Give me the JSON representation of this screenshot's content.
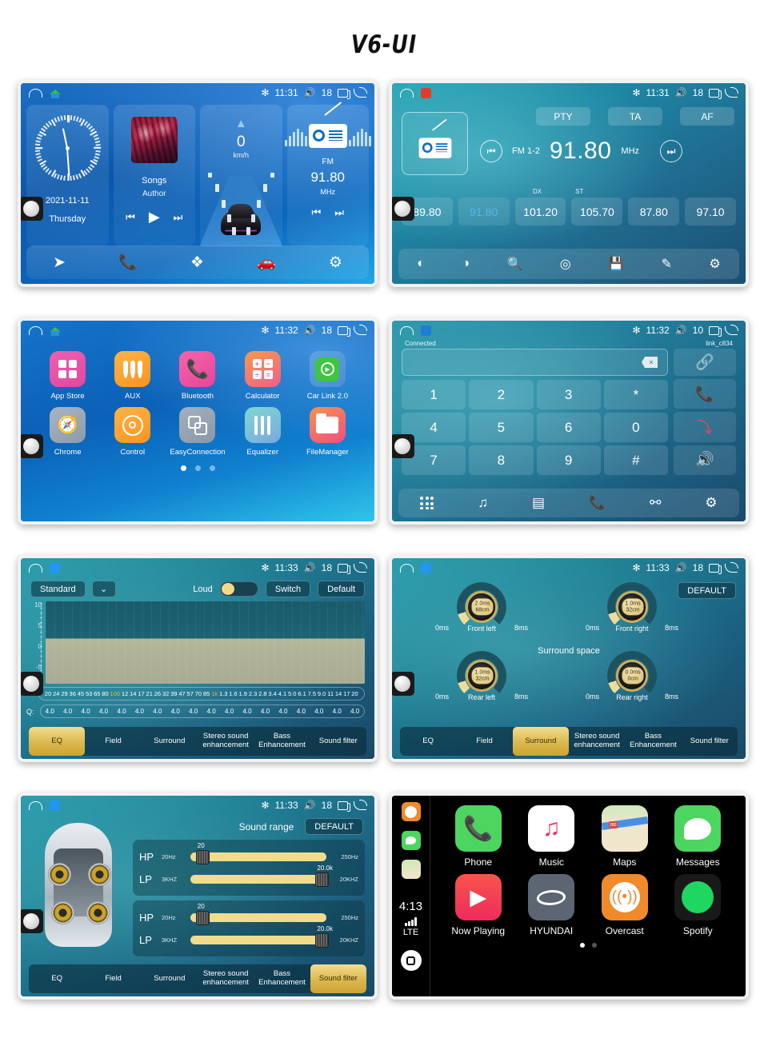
{
  "title": "V6-UI",
  "screens": {
    "home": {
      "name": "home-screen",
      "status": {
        "time": "11:31",
        "volume": "18"
      },
      "clock": {
        "date": "2021-11-11",
        "day": "Thursday"
      },
      "music": {
        "title": "Songs",
        "artist": "Author"
      },
      "speed": {
        "value": "0",
        "unit": "km/h"
      },
      "radio": {
        "band": "FM",
        "freq": "91.80",
        "unit": "MHz"
      },
      "dock": [
        "navigation-icon",
        "phone-icon",
        "apps-icon",
        "carplay-icon",
        "settings-icon"
      ]
    },
    "radio": {
      "name": "radio-screen",
      "status": {
        "time": "11:31",
        "volume": "18"
      },
      "buttons": [
        "PTY",
        "TA",
        "AF"
      ],
      "band": "FM 1-2",
      "freq": "91.80",
      "unit": "MHz",
      "dx": "DX",
      "st": "ST",
      "presets": [
        "89.80",
        "91.80",
        "101.20",
        "105.70",
        "87.80",
        "97.10"
      ],
      "active_preset_index": 1
    },
    "apps": {
      "name": "app-drawer-screen",
      "status": {
        "time": "11:32",
        "volume": "18"
      },
      "items": [
        {
          "label": "App Store",
          "icon": "grid-icon"
        },
        {
          "label": "AUX",
          "icon": "aux-icon"
        },
        {
          "label": "Bluetooth",
          "icon": "phone-icon"
        },
        {
          "label": "Calculator",
          "icon": "calculator-icon"
        },
        {
          "label": "Car Link 2.0",
          "icon": "carlink-icon"
        },
        {
          "label": "Chrome",
          "icon": "compass-icon"
        },
        {
          "label": "Control",
          "icon": "steering-wheel-icon"
        },
        {
          "label": "EasyConnection",
          "icon": "mirror-icon"
        },
        {
          "label": "Equalizer",
          "icon": "sliders-icon"
        },
        {
          "label": "FileManager",
          "icon": "folder-icon"
        }
      ],
      "pages": 3,
      "active_page": 0
    },
    "bluetooth": {
      "name": "bluetooth-dialer-screen",
      "status": {
        "time": "11:32",
        "volume": "10"
      },
      "connection_status": "Connected",
      "device_name": "link_c834",
      "dial_value": "",
      "keys": [
        "1",
        "2",
        "3",
        "4",
        "5",
        "6",
        "7",
        "8",
        "9",
        "*",
        "0",
        "#"
      ],
      "actions": [
        "link-icon",
        "call-icon",
        "hangup-icon",
        "speaker-icon"
      ],
      "dock": [
        "dialpad-icon",
        "music-icon",
        "contacts-icon",
        "call-log-icon",
        "disconnect-icon",
        "settings-icon"
      ]
    },
    "equalizer": {
      "name": "equalizer-screen",
      "status": {
        "time": "11:33",
        "volume": "18"
      },
      "preset": "Standard",
      "loud_label": "Loud",
      "loud_on": true,
      "switch_label": "Switch",
      "default_label": "Default",
      "y_axis": [
        "10",
        "5",
        "0",
        "-5"
      ],
      "frequencies": [
        "20",
        "24",
        "29",
        "36",
        "45",
        "53",
        "65",
        "80",
        "100",
        "12",
        "14",
        "17",
        "21",
        "26",
        "32",
        "39",
        "47",
        "57",
        "70",
        "85",
        "1k",
        "1.3",
        "1.6",
        "1.9",
        "2.3",
        "2.8",
        "3.4",
        "4.1",
        "5.0",
        "6.1",
        "7.5",
        "9.0",
        "11",
        "14",
        "17",
        "20"
      ],
      "highlight_freqs": [
        "100",
        "1k"
      ],
      "q_label": "Q:",
      "q_values": [
        "4.0",
        "4.0",
        "4.0",
        "4.0",
        "4.0",
        "4.0",
        "4.0",
        "4.0",
        "4.0",
        "4.0",
        "4.0",
        "4.0",
        "4.0",
        "4.0",
        "4.0",
        "4.0",
        "4.0",
        "4.0"
      ],
      "tabs": [
        "EQ",
        "Field",
        "Surround",
        "Stereo sound enhancement",
        "Bass Enhancement",
        "Sound filter"
      ],
      "active_tab": 0
    },
    "surround": {
      "name": "surround-screen",
      "status": {
        "time": "11:33",
        "volume": "18"
      },
      "default_label": "DEFAULT",
      "section_title": "Surround space",
      "knobs": [
        {
          "name": "Front left",
          "delay": "2.0ms",
          "distance": "68cm",
          "min": "0ms",
          "max": "8ms"
        },
        {
          "name": "Front right",
          "delay": "1.0ms",
          "distance": "32cm",
          "min": "0ms",
          "max": "8ms"
        },
        {
          "name": "Rear left",
          "delay": "1.0ms",
          "distance": "32cm",
          "min": "0ms",
          "max": "8ms"
        },
        {
          "name": "Rear right",
          "delay": "0.0ms",
          "distance": "0cm",
          "min": "0ms",
          "max": "8ms"
        }
      ],
      "tabs": [
        "EQ",
        "Field",
        "Surround",
        "Stereo sound enhancement",
        "Bass Enhancement",
        "Sound filter"
      ],
      "active_tab": 2
    },
    "soundfilter": {
      "name": "sound-filter-screen",
      "status": {
        "time": "11:33",
        "volume": "18"
      },
      "section_title": "Sound range",
      "default_label": "DEFAULT",
      "groups": [
        {
          "rows": [
            {
              "tag": "HP",
              "min": "20Hz",
              "max": "250Hz",
              "value": "20",
              "pos": 4
            },
            {
              "tag": "LP",
              "min": "3KHZ",
              "max": "20KHZ",
              "value": "20.0k",
              "pos": 92
            }
          ]
        },
        {
          "rows": [
            {
              "tag": "HP",
              "min": "20Hz",
              "max": "250Hz",
              "value": "20",
              "pos": 4
            },
            {
              "tag": "LP",
              "min": "3KHZ",
              "max": "20KHZ",
              "value": "20.0k",
              "pos": 92
            }
          ]
        }
      ],
      "tabs": [
        "EQ",
        "Field",
        "Surround",
        "Stereo sound enhancement",
        "Bass Enhancement",
        "Sound filter"
      ],
      "active_tab": 5
    },
    "carplay": {
      "name": "carplay-screen",
      "time": "4:13",
      "network": "LTE",
      "apps": [
        {
          "label": "Phone",
          "icon": "phone-icon"
        },
        {
          "label": "Music",
          "icon": "music-note-icon"
        },
        {
          "label": "Maps",
          "icon": "map-icon"
        },
        {
          "label": "Messages",
          "icon": "message-bubble-icon"
        },
        {
          "label": "Now Playing",
          "icon": "play-icon"
        },
        {
          "label": "HYUNDAI",
          "icon": "hyundai-logo-icon"
        },
        {
          "label": "Overcast",
          "icon": "broadcast-icon"
        },
        {
          "label": "Spotify",
          "icon": "spotify-icon"
        }
      ],
      "map_badge": "280",
      "pages": 2,
      "active_page": 0
    }
  }
}
